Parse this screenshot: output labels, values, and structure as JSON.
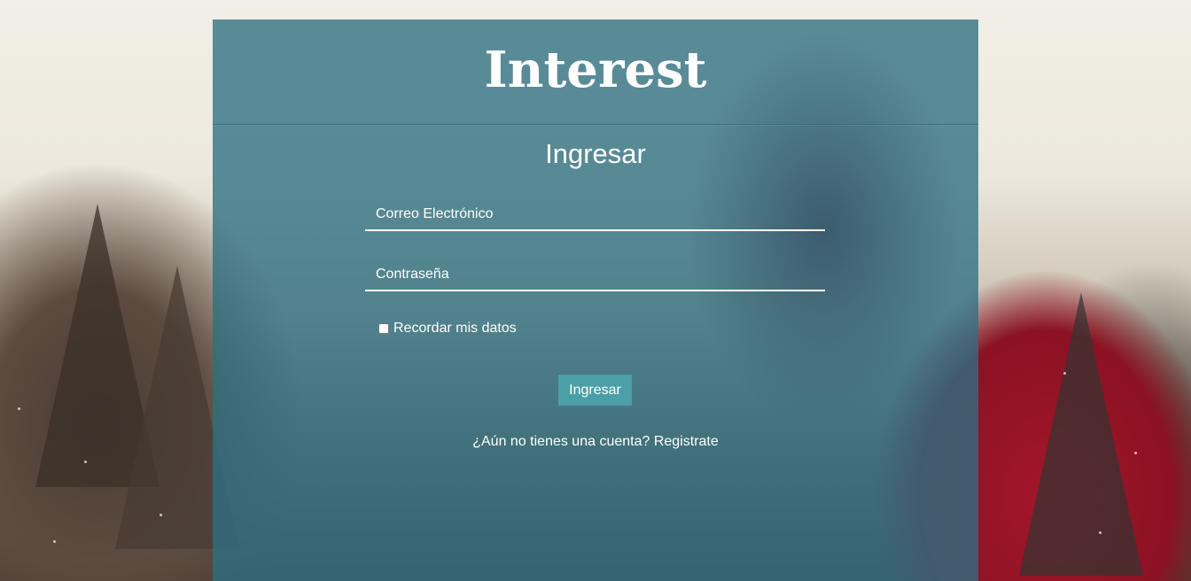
{
  "brand": {
    "name": "Interest"
  },
  "login_form": {
    "title": "Ingresar",
    "email_placeholder": "Correo Electrónico",
    "password_placeholder": "Contraseña",
    "remember_label": "Recordar mis datos",
    "remember_checked": false,
    "submit_label": "Ingresar",
    "register_prompt": "¿Aún no tienes una cuenta?",
    "register_link": "Registrate"
  },
  "colors": {
    "panel_overlay": "#2e7082",
    "button_bg": "#4aa0a6",
    "text": "#ffffff"
  }
}
